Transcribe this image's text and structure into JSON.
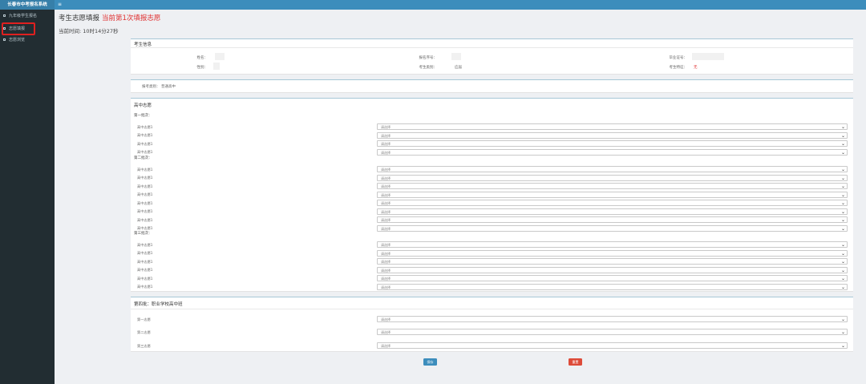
{
  "app": {
    "title": "长春市中考报名系统"
  },
  "sidebar": {
    "items": [
      {
        "label": "九年级学生报名"
      },
      {
        "label": "志愿填报"
      },
      {
        "label": "志愿浏览"
      }
    ]
  },
  "header": {
    "title": "考生志愿填报",
    "round_notice": "当前第1次填报志愿",
    "current_time": "当前时间: 10时14分27秒"
  },
  "student_info": {
    "section_title": "考生信息",
    "fields": [
      {
        "label": "姓名："
      },
      {
        "label": "报名序号："
      },
      {
        "label": "毕业证号："
      },
      {
        "label": "性别："
      },
      {
        "label": "考生类别：",
        "value": "应届"
      },
      {
        "label": "考生特征：",
        "value": "无"
      }
    ]
  },
  "option_row": {
    "label": "报考类别：",
    "value": "普通高中"
  },
  "high_school": {
    "section_title": "高中志愿",
    "batch1_label": "第一批次：",
    "batch2_label": "第二批次：",
    "batch3_label": "第三批次：",
    "row_label": "高中志愿1",
    "select_placeholder": "请选择"
  },
  "vocational": {
    "section_title": "第四批：职业学校高中班",
    "rows": [
      {
        "label": "第一志愿"
      },
      {
        "label": "第二志愿"
      },
      {
        "label": "第三志愿"
      }
    ],
    "select_placeholder": "请选择"
  },
  "buttons": {
    "save": "保存",
    "reset": "重置"
  },
  "icons": {
    "menu": "menu-icon",
    "chevron": "chevron-down-icon",
    "nav": "square-icon"
  },
  "colors": {
    "topbar": "#3c8dbc",
    "sidebar": "#222d32",
    "notice": "#e03030",
    "save": "#3c8dbc",
    "reset": "#dd4b39"
  }
}
